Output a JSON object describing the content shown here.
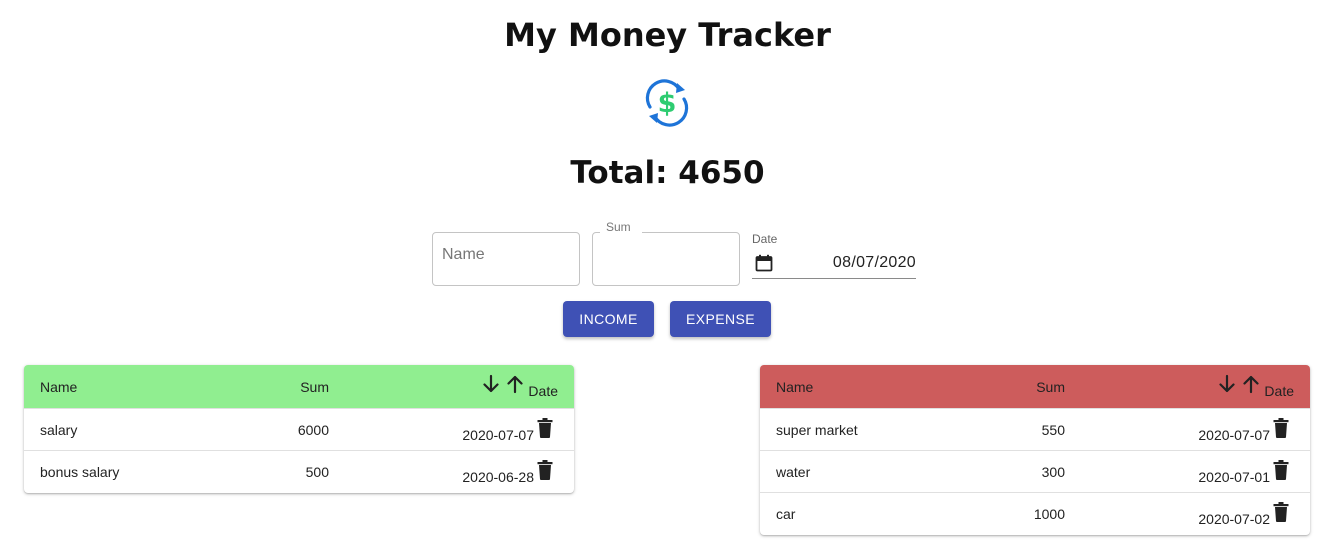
{
  "app": {
    "title": "My Money Tracker",
    "logo_icon": "dollar-exchange-icon",
    "total_text": "Total: 4650"
  },
  "form": {
    "name_placeholder": "Name",
    "sum_label": "Sum",
    "date_label": "Date",
    "date_value": "08/07/2020",
    "income_label": "INCOME",
    "expense_label": "EXPENSE"
  },
  "colors": {
    "accent": "#3f51b5",
    "income_header": "#90ee90",
    "expense_header": "#cd5c5c"
  },
  "income_table": {
    "headers": {
      "name": "Name",
      "sum": "Sum",
      "date": "Date"
    },
    "rows": [
      {
        "name": "salary",
        "sum": "6000",
        "date": "2020-07-07"
      },
      {
        "name": "bonus salary",
        "sum": "500",
        "date": "2020-06-28"
      }
    ]
  },
  "expense_table": {
    "headers": {
      "name": "Name",
      "sum": "Sum",
      "date": "Date"
    },
    "rows": [
      {
        "name": "super market",
        "sum": "550",
        "date": "2020-07-07"
      },
      {
        "name": "water",
        "sum": "300",
        "date": "2020-07-01"
      },
      {
        "name": "car",
        "sum": "1000",
        "date": "2020-07-02"
      }
    ]
  }
}
